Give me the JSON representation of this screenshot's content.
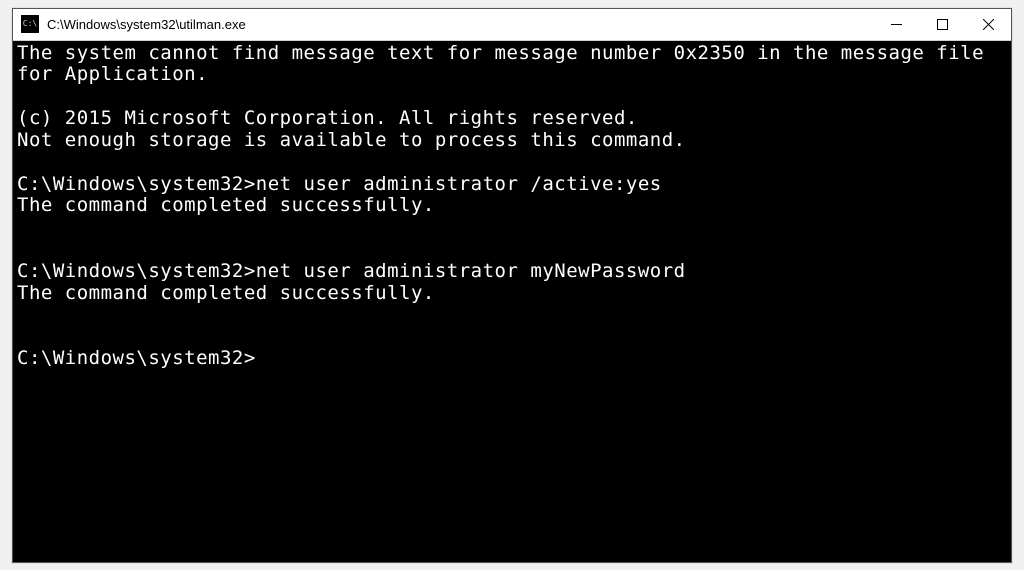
{
  "window": {
    "title": "C:\\Windows\\system32\\utilman.exe"
  },
  "terminal": {
    "lines": [
      "The system cannot find message text for message number 0x2350 in the message file for Application.",
      "",
      "(c) 2015 Microsoft Corporation. All rights reserved.",
      "Not enough storage is available to process this command.",
      "",
      "C:\\Windows\\system32>net user administrator /active:yes",
      "The command completed successfully.",
      "",
      "",
      "C:\\Windows\\system32>net user administrator myNewPassword",
      "The command completed successfully.",
      "",
      ""
    ],
    "prompt": "C:\\Windows\\system32>"
  },
  "icons": {
    "minimize": "—",
    "maximize": "☐",
    "close": "✕"
  }
}
